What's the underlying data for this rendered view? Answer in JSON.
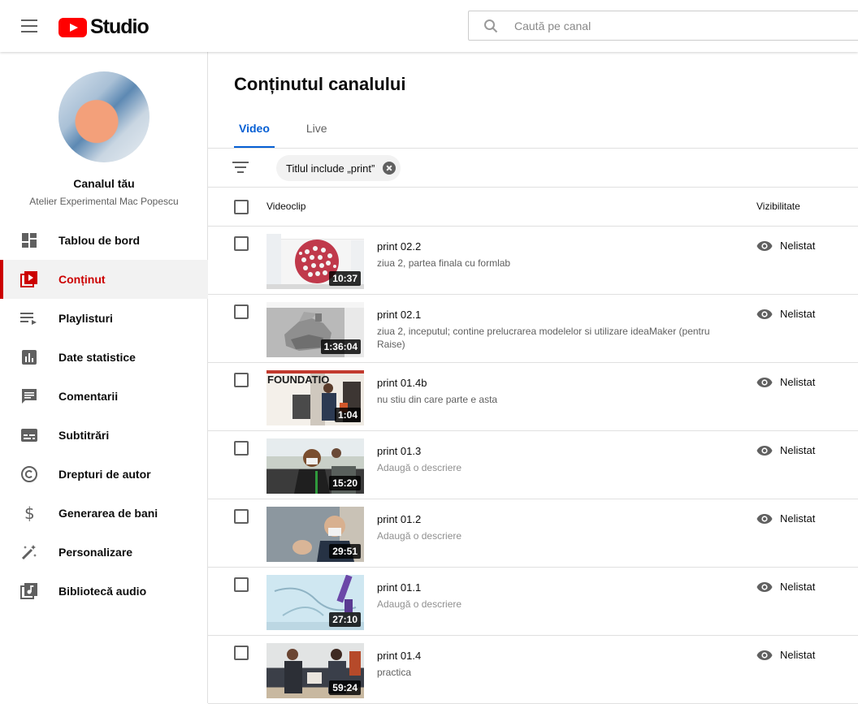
{
  "header": {
    "logo_text": "Studio",
    "search_placeholder": "Caută pe canal"
  },
  "sidebar": {
    "channel_title": "Canalul tău",
    "channel_name": "Atelier Experimental Mac Popescu",
    "items": [
      {
        "label": "Tablou de bord",
        "icon": "dashboard-icon"
      },
      {
        "label": "Conținut",
        "icon": "content-icon",
        "active": true
      },
      {
        "label": "Playlisturi",
        "icon": "playlist-icon"
      },
      {
        "label": "Date statistice",
        "icon": "analytics-icon"
      },
      {
        "label": "Comentarii",
        "icon": "comments-icon"
      },
      {
        "label": "Subtitrări",
        "icon": "subtitles-icon"
      },
      {
        "label": "Drepturi de autor",
        "icon": "copyright-icon"
      },
      {
        "label": "Generarea de bani",
        "icon": "dollar-icon"
      },
      {
        "label": "Personalizare",
        "icon": "magic-wand-icon"
      },
      {
        "label": "Bibliotecă audio",
        "icon": "audio-library-icon"
      }
    ]
  },
  "main": {
    "title": "Conținutul canalului",
    "tabs": [
      {
        "label": "Video",
        "active": true
      },
      {
        "label": "Live",
        "active": false
      }
    ],
    "filter_chip": "Titlul include „print”",
    "columns": {
      "video": "Videoclip",
      "visibility": "Vizibilitate"
    },
    "videos": [
      {
        "title": "print 02.2",
        "description": "ziua 2, partea finala cu formlab",
        "duration": "10:37",
        "visibility": "Nelistat"
      },
      {
        "title": "print 02.1",
        "description": "ziua 2, inceputul; contine prelucrarea modelelor si utilizare ideaMaker (pentru Raise)",
        "duration": "1:36:04",
        "visibility": "Nelistat"
      },
      {
        "title": "print 01.4b",
        "description": "nu stiu din care parte e asta",
        "duration": "1:04",
        "visibility": "Nelistat"
      },
      {
        "title": "print 01.3",
        "description": "Adaugă o descriere",
        "placeholder": true,
        "duration": "15:20",
        "visibility": "Nelistat"
      },
      {
        "title": "print 01.2",
        "description": "Adaugă o descriere",
        "placeholder": true,
        "duration": "29:51",
        "visibility": "Nelistat"
      },
      {
        "title": "print 01.1",
        "description": "Adaugă o descriere",
        "placeholder": true,
        "duration": "27:10",
        "visibility": "Nelistat"
      },
      {
        "title": "print 01.4",
        "description": "practica",
        "duration": "59:24",
        "visibility": "Nelistat"
      }
    ],
    "thumb_text_3": "FOUNDATIO"
  },
  "colors": {
    "accent": "#065fd4",
    "active_nav": "#cc0000",
    "brand": "#ff0000"
  }
}
